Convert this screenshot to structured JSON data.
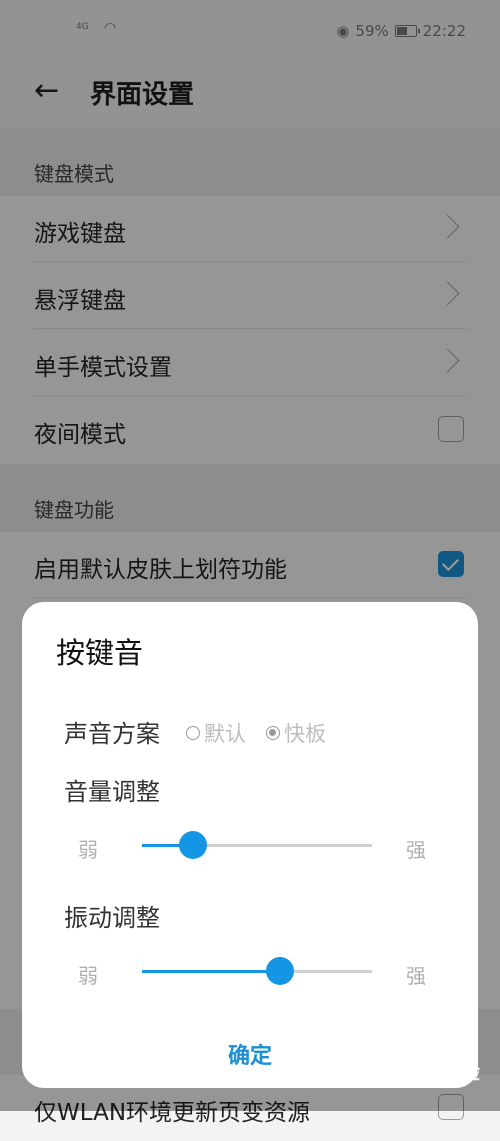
{
  "status_bar": {
    "signal": "4G",
    "battery_percent": "59%",
    "battery_level": 0.59,
    "time": "22:22"
  },
  "header": {
    "title": "界面设置"
  },
  "sections": {
    "keyboard_mode": "键盘模式",
    "keyboard_function": "键盘功能"
  },
  "rows": {
    "game_keyboard": "游戏键盘",
    "floating_keyboard": "悬浮键盘",
    "one_hand": "单手模式设置",
    "night_mode": "夜间模式",
    "swipe_symbol": "启用默认皮肤上划符功能",
    "wlan_only": "仅WLAN环境更新页变资源"
  },
  "checkboxes": {
    "night_mode_checked": false,
    "swipe_symbol_checked": true,
    "wlan_only_checked": false
  },
  "dialog": {
    "title": "按键音",
    "sound_scheme_label": "声音方案",
    "options": [
      "默认",
      "快板"
    ],
    "selected_option": "快板",
    "volume_label": "音量调整",
    "volume_level": 0.22,
    "vibration_label": "振动调整",
    "vibration_level": 0.6,
    "weak_label": "弱",
    "strong_label": "强",
    "confirm": "确定"
  },
  "watermark": "Bai 经验"
}
